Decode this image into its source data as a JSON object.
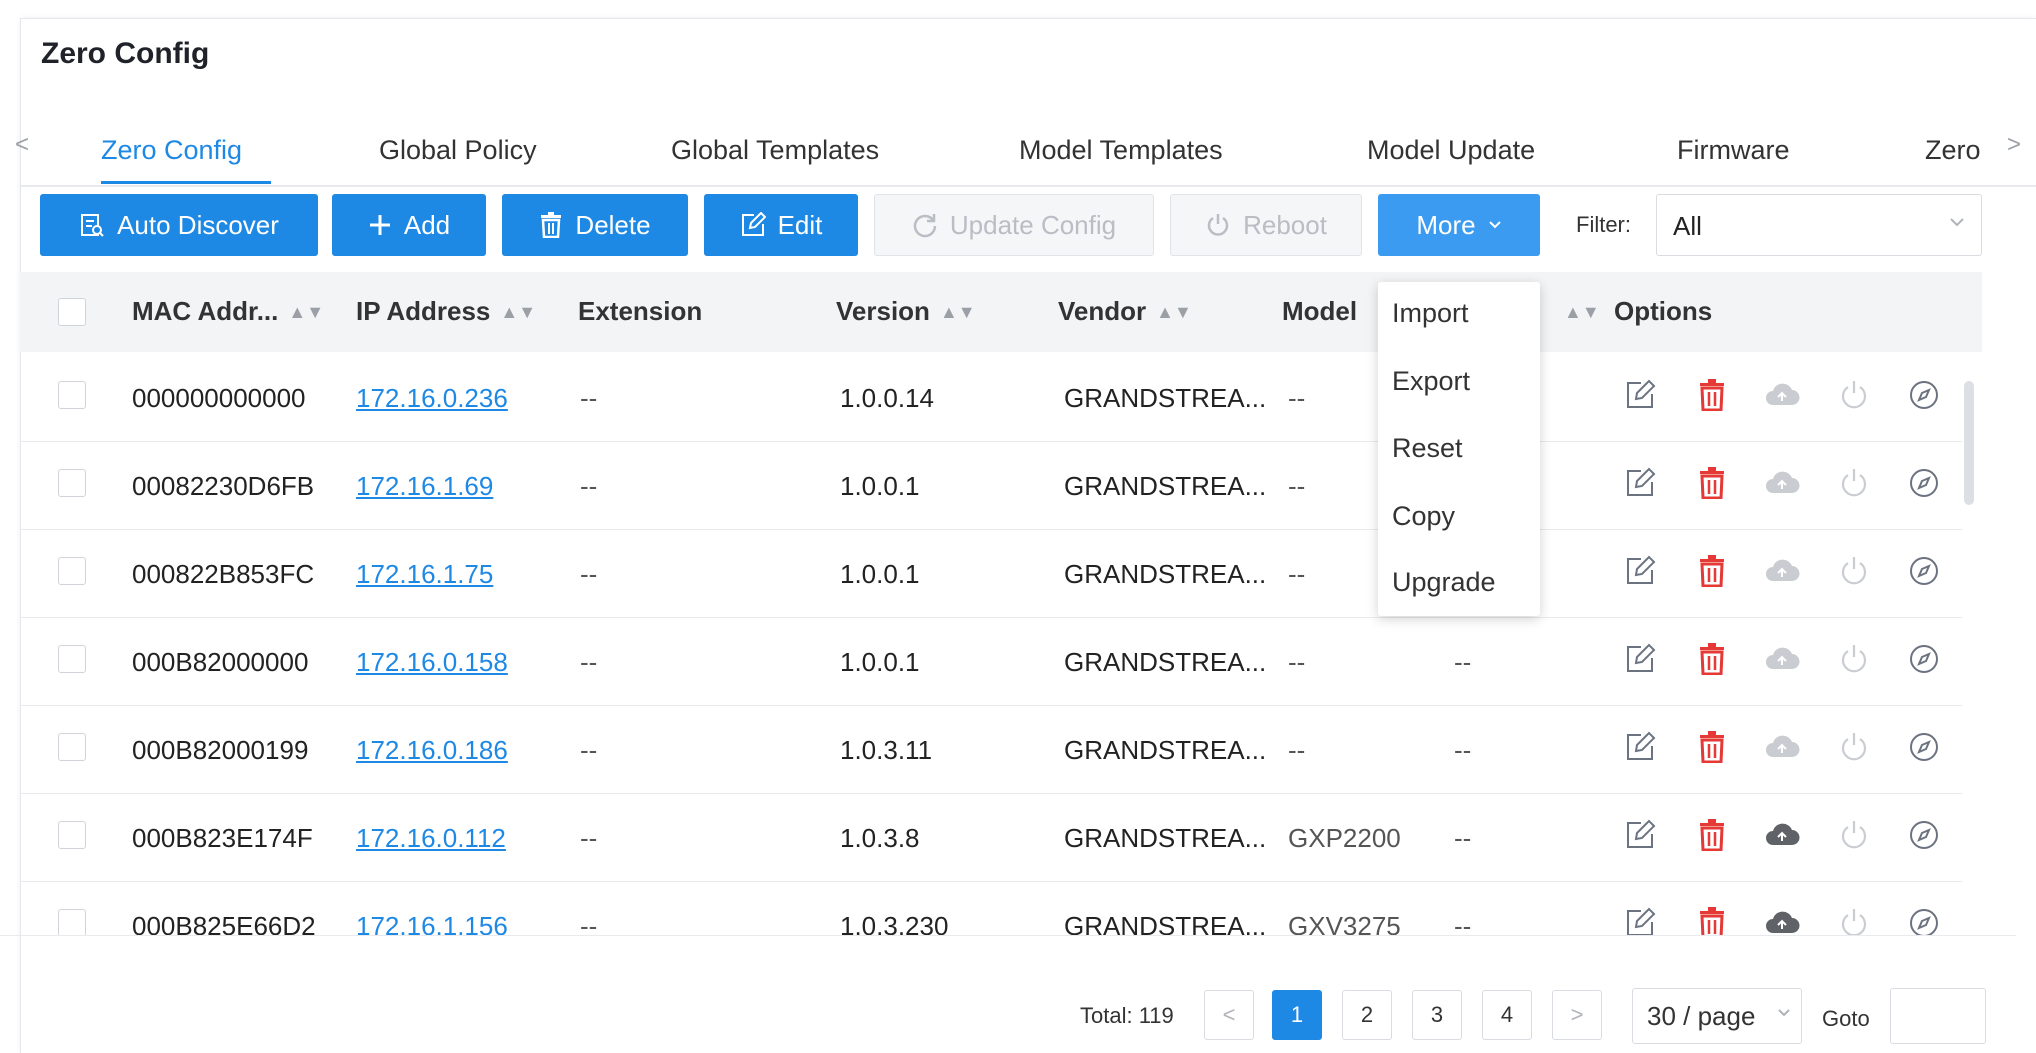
{
  "page_title": "Zero Config",
  "tabs": [
    {
      "label": "Zero Config",
      "active": true
    },
    {
      "label": "Global Policy"
    },
    {
      "label": "Global Templates"
    },
    {
      "label": "Model Templates"
    },
    {
      "label": "Model Update"
    },
    {
      "label": "Firmware"
    },
    {
      "label": "Zero"
    }
  ],
  "tab_nav": {
    "prev": "<",
    "next": ">"
  },
  "toolbar": {
    "auto_discover": "Auto Discover",
    "add": "Add",
    "delete": "Delete",
    "edit": "Edit",
    "update_config": "Update Config",
    "reboot": "Reboot",
    "more": "More",
    "filter_label": "Filter:",
    "filter_value": "All"
  },
  "more_menu": [
    "Import",
    "Export",
    "Reset",
    "Copy",
    "Upgrade"
  ],
  "table": {
    "headers": {
      "mac": "MAC Addr...",
      "ip": "IP Address",
      "extension": "Extension",
      "version": "Version",
      "vendor": "Vendor",
      "model": "Model",
      "options": "Options"
    },
    "rows": [
      {
        "mac": "000000000000",
        "ip": "172.16.0.236",
        "extension": "--",
        "version": "1.0.0.14",
        "vendor": "GRANDSTREA...",
        "model": "--",
        "extra": "",
        "cloud_active": false
      },
      {
        "mac": "00082230D6FB",
        "ip": "172.16.1.69",
        "extension": "--",
        "version": "1.0.0.1",
        "vendor": "GRANDSTREA...",
        "model": "--",
        "extra": "",
        "cloud_active": false
      },
      {
        "mac": "000822B853FC",
        "ip": "172.16.1.75",
        "extension": "--",
        "version": "1.0.0.1",
        "vendor": "GRANDSTREA...",
        "model": "--",
        "extra": "",
        "cloud_active": false
      },
      {
        "mac": "000B82000000",
        "ip": "172.16.0.158",
        "extension": "--",
        "version": "1.0.0.1",
        "vendor": "GRANDSTREA...",
        "model": "--",
        "extra": "--",
        "cloud_active": false
      },
      {
        "mac": "000B82000199",
        "ip": "172.16.0.186",
        "extension": "--",
        "version": "1.0.3.11",
        "vendor": "GRANDSTREA...",
        "model": "--",
        "extra": "--",
        "cloud_active": false
      },
      {
        "mac": "000B823E174F",
        "ip": "172.16.0.112",
        "extension": "--",
        "version": "1.0.3.8",
        "vendor": "GRANDSTREA...",
        "model": "GXP2200",
        "extra": "--",
        "cloud_active": true
      },
      {
        "mac": "000B825E66D2",
        "ip": "172.16.1.156",
        "extension": "--",
        "version": "1.0.3.230",
        "vendor": "GRANDSTREA...",
        "model": "GXV3275",
        "extra": "--",
        "cloud_active": true
      }
    ]
  },
  "pagination": {
    "total": "Total: 119",
    "pages": [
      "1",
      "2",
      "3",
      "4"
    ],
    "current": "1",
    "prev": "<",
    "next": ">",
    "page_size": "30 / page",
    "goto_label": "Goto"
  },
  "colors": {
    "accent": "#1e88e5",
    "danger": "#e53935",
    "disabled": "#b9bdc4"
  }
}
